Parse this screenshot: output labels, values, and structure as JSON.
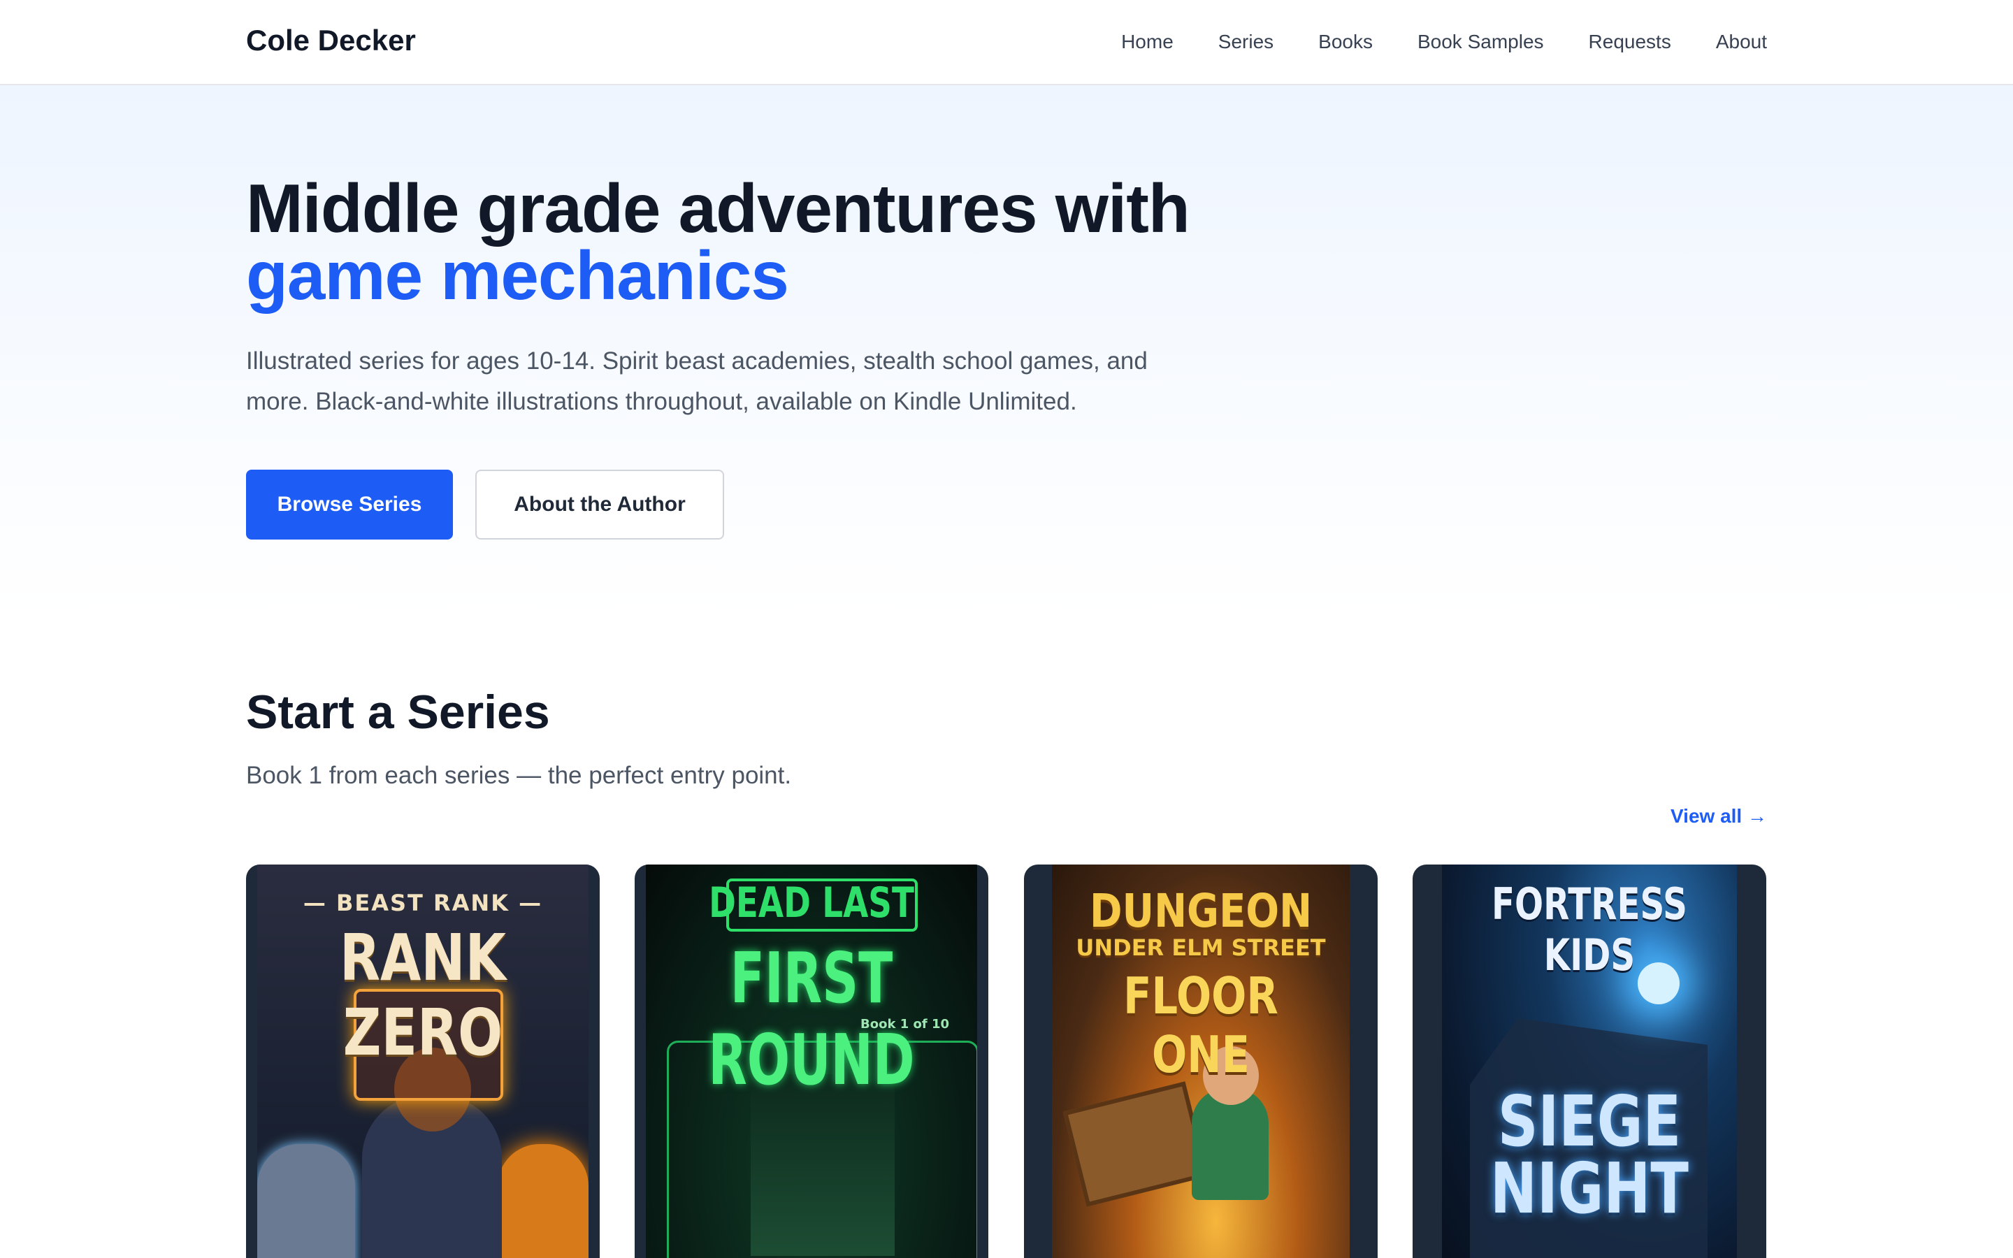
{
  "nav": {
    "brand": "Cole Decker",
    "links": [
      "Home",
      "Series",
      "Books",
      "Book Samples",
      "Requests",
      "About"
    ]
  },
  "hero": {
    "title_line1": "Middle grade adventures with",
    "title_line2": "game mechanics",
    "subtitle": "Illustrated series for ages 10-14. Spirit beast academies, stealth school games, and more. Black-and-white illustrations throughout, available on Kindle Unlimited.",
    "primary_button": "Browse Series",
    "secondary_button": "About the Author"
  },
  "series_section": {
    "title": "Start a Series",
    "subtitle": "Book 1 from each series — the perfect entry point.",
    "view_all": "View all →"
  },
  "books": [
    {
      "kicker": "— BEAST RANK —",
      "title": "RANK ZERO"
    },
    {
      "kicker": "DEAD LAST",
      "title": "FIRST ROUND",
      "note": "Book 1 of 10"
    },
    {
      "kicker": "DUNGEON",
      "subkicker": "UNDER ELM STREET",
      "title": "FLOOR ONE"
    },
    {
      "kicker": "FORTRESS KIDS",
      "title": "SIEGE NIGHT"
    }
  ],
  "colors": {
    "accent": "#1d5cf5",
    "text": "#111827",
    "muted": "#4b5563"
  }
}
